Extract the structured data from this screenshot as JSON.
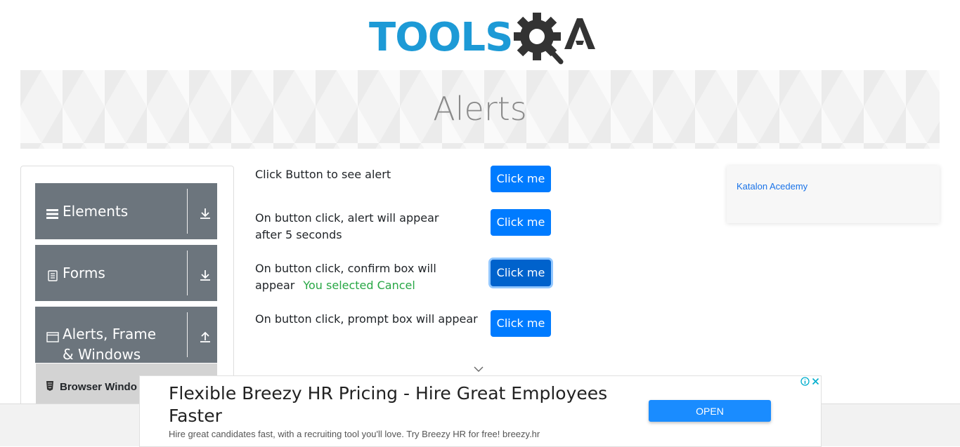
{
  "header": {
    "logo_text": "TOOLS",
    "logo_suffix": "QA"
  },
  "banner": {
    "title": "Alerts"
  },
  "sidebar": {
    "groups": [
      {
        "label": "Elements",
        "icon": "list-icon",
        "arrow": "download-arrow-icon"
      },
      {
        "label": "Forms",
        "icon": "document-icon",
        "arrow": "download-arrow-icon"
      },
      {
        "label": "Alerts, Frame & Windows",
        "icon": "window-icon",
        "arrow": "upload-arrow-icon"
      }
    ],
    "items": [
      {
        "label": "Browser Windows",
        "icon": "html5-icon"
      }
    ]
  },
  "main": {
    "rows": [
      {
        "text": "Click Button to see alert",
        "button": "Click me"
      },
      {
        "text": "On button click, alert will appear after 5 seconds",
        "button": "Click me"
      },
      {
        "text": "On button click, confirm box will appear",
        "button": "Click me",
        "result": "You selected Cancel"
      },
      {
        "text": "On button click, prompt box will appear",
        "button": "Click me"
      }
    ]
  },
  "side_ad": {
    "link": "Katalon Acedemy"
  },
  "bottom_ad": {
    "title": "Flexible Breezy HR Pricing - Hire Great Employees Faster",
    "description": "Hire great candidates fast, with a recruiting tool you'll love. Try Breezy HR for free! breezy.hr",
    "cta": "OPEN"
  },
  "colors": {
    "primary_button": "#007bff",
    "sidebar_header": "#6c757d",
    "result_text": "#28a745",
    "logo_blue": "#1d9ad6"
  }
}
